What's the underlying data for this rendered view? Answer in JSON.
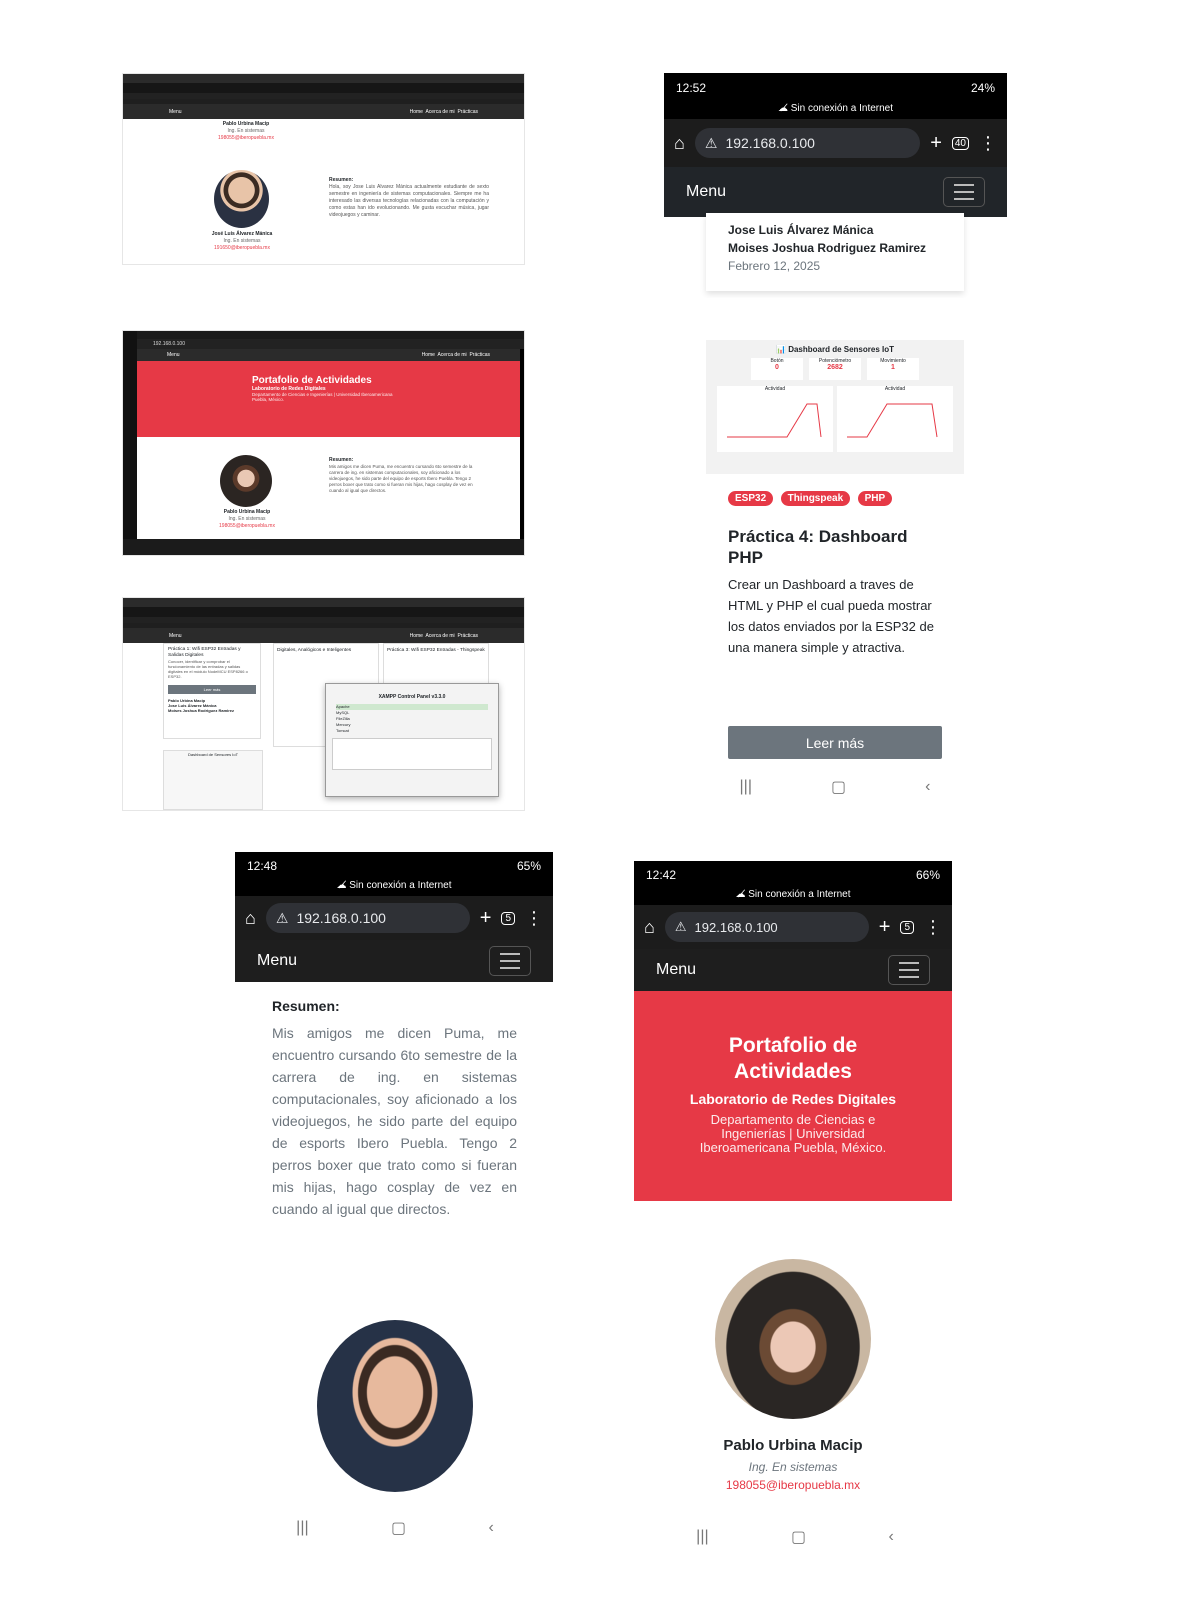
{
  "desktop1": {
    "nav_links": [
      "Home",
      "Acerca de mi",
      "Prácticas"
    ],
    "menu": "Menu",
    "top_name": "Pablo Urbina Macip",
    "top_role": "Ing. En sistemas",
    "top_email": "198055@iberopuebla.mx",
    "person_name": "José Luis Álvarez Mánica",
    "person_role": "Ing. En sistemas",
    "person_email": "191650@iberopuebla.mx",
    "resumen_label": "Resumen:",
    "resumen_text": "Hola, soy Jose Luis Alvarez Mánica actualmente estudiante de sexto semestre en ingeniería de sistemas computacionales. Siempre me ha interesado las diversas tecnologías relacionadas con la computación y como estas han ido evolucionando. Me gusta escuchar música, jugar videojuegos y caminar."
  },
  "desktop2": {
    "url": "192.168.0.100",
    "menu": "Menu",
    "nav_links": [
      "Home",
      "Acerca de mi",
      "Prácticas"
    ],
    "hero_title": "Portafolio de Actividades",
    "hero_subtitle": "Laboratorio de Redes Digitales",
    "hero_dept": "Departamento de Ciencias e Ingenierías | Universidad Iberoamericana Puebla, México.",
    "person_name": "Pablo Urbina Macip",
    "person_role": "Ing. En sistemas",
    "person_email": "198055@iberopuebla.mx",
    "resumen_label": "Resumen:",
    "resumen_text": "Mis amigos me dicen Puma, me encuentro cursando 6to semestre de la carrera de ing. en sistemas computacionales, soy aficionado a los videojuegos, he sido parte del equipo de esports Ibero Puebla. Tengo 2 perros boxer que trato como si fueran mis hijas, hago cosplay de vez en cuando al igual que directos."
  },
  "desktop3": {
    "menu": "Menu",
    "nav_links": [
      "Home",
      "Acerca de mi",
      "Prácticas"
    ],
    "card1_title": "Práctica 1: Wifi ESP32 Entradas y Salidas Digitales",
    "card1_text": "Conocer, identificar y comprobar el funcionamiento de las entradas y salidas digitales en el módulo NodeMCU ESP8266 o ESP32.",
    "card1_button": "Leer más",
    "card1_authors": [
      "Pablo Urbina Macip",
      "Jose Luis Álvarez Mánica",
      "Moises Joshua Rodriguez Ramirez"
    ],
    "card2_title": "Digitales, Analógicos e Inteligentes",
    "card3_title": "Práctica 3: Wifi ESP32 Entradas - Thingspeak",
    "xampp_title": "XAMPP Control Panel v3.3.0",
    "xampp_modules": [
      "Apache",
      "MySQL",
      "FileZilla",
      "Mercury",
      "Tomcat"
    ],
    "dash_label": "Dashboard de Sensores IoT"
  },
  "phone1": {
    "time": "12:52",
    "battery": "24%",
    "offline": "Sin conexión a Internet",
    "url": "192.168.0.100",
    "tabs": "40",
    "menu": "Menu",
    "author1": "Jose Luis Álvarez Mánica",
    "author2": "Moises Joshua Rodriguez Ramirez",
    "date": "Febrero 12, 2025"
  },
  "phone2": {
    "dash_title": "Dashboard de Sensores IoT",
    "metrics": [
      {
        "label": "Botón",
        "value": "0"
      },
      {
        "label": "Potenciómetro",
        "value": "2682"
      },
      {
        "label": "Movimiento",
        "value": "1"
      }
    ],
    "chart_label": "Actividad",
    "tags": [
      "ESP32",
      "Thingspeak",
      "PHP"
    ],
    "title": "Práctica 4: Dashboard PHP",
    "text": "Crear un Dashboard a traves de HTML y PHP el cual pueda mostrar los datos enviados por la ESP32 de una manera simple y atractiva.",
    "button": "Leer más"
  },
  "phone3": {
    "time": "12:48",
    "battery": "65%",
    "offline": "Sin conexión a Internet",
    "url": "192.168.0.100",
    "tabs": "5",
    "menu": "Menu",
    "resumen_label": "Resumen:",
    "resumen_text": "Mis amigos me dicen Puma, me encuentro cursando 6to semestre de la carrera de ing. en sistemas computacionales, soy aficionado a los videojuegos, he sido parte del equipo de esports Ibero Puebla. Tengo 2 perros boxer que trato como si fueran mis hijas, hago cosplay de vez en cuando al igual que directos."
  },
  "phone4": {
    "time": "12:42",
    "battery": "66%",
    "offline": "Sin conexión a Internet",
    "url": "192.168.0.100",
    "tabs": "5",
    "menu": "Menu",
    "hero_title": "Portafolio de Actividades",
    "hero_subtitle": "Laboratorio de Redes Digitales",
    "hero_dept": "Departamento de Ciencias e Ingenierías | Universidad Iberoamericana Puebla, México.",
    "person_name": "Pablo Urbina Macip",
    "person_role": "Ing. En sistemas",
    "person_email": "198055@iberopuebla.mx"
  },
  "colors": {
    "accent": "#e63946",
    "navbar": "#212529",
    "status": "#000000"
  }
}
